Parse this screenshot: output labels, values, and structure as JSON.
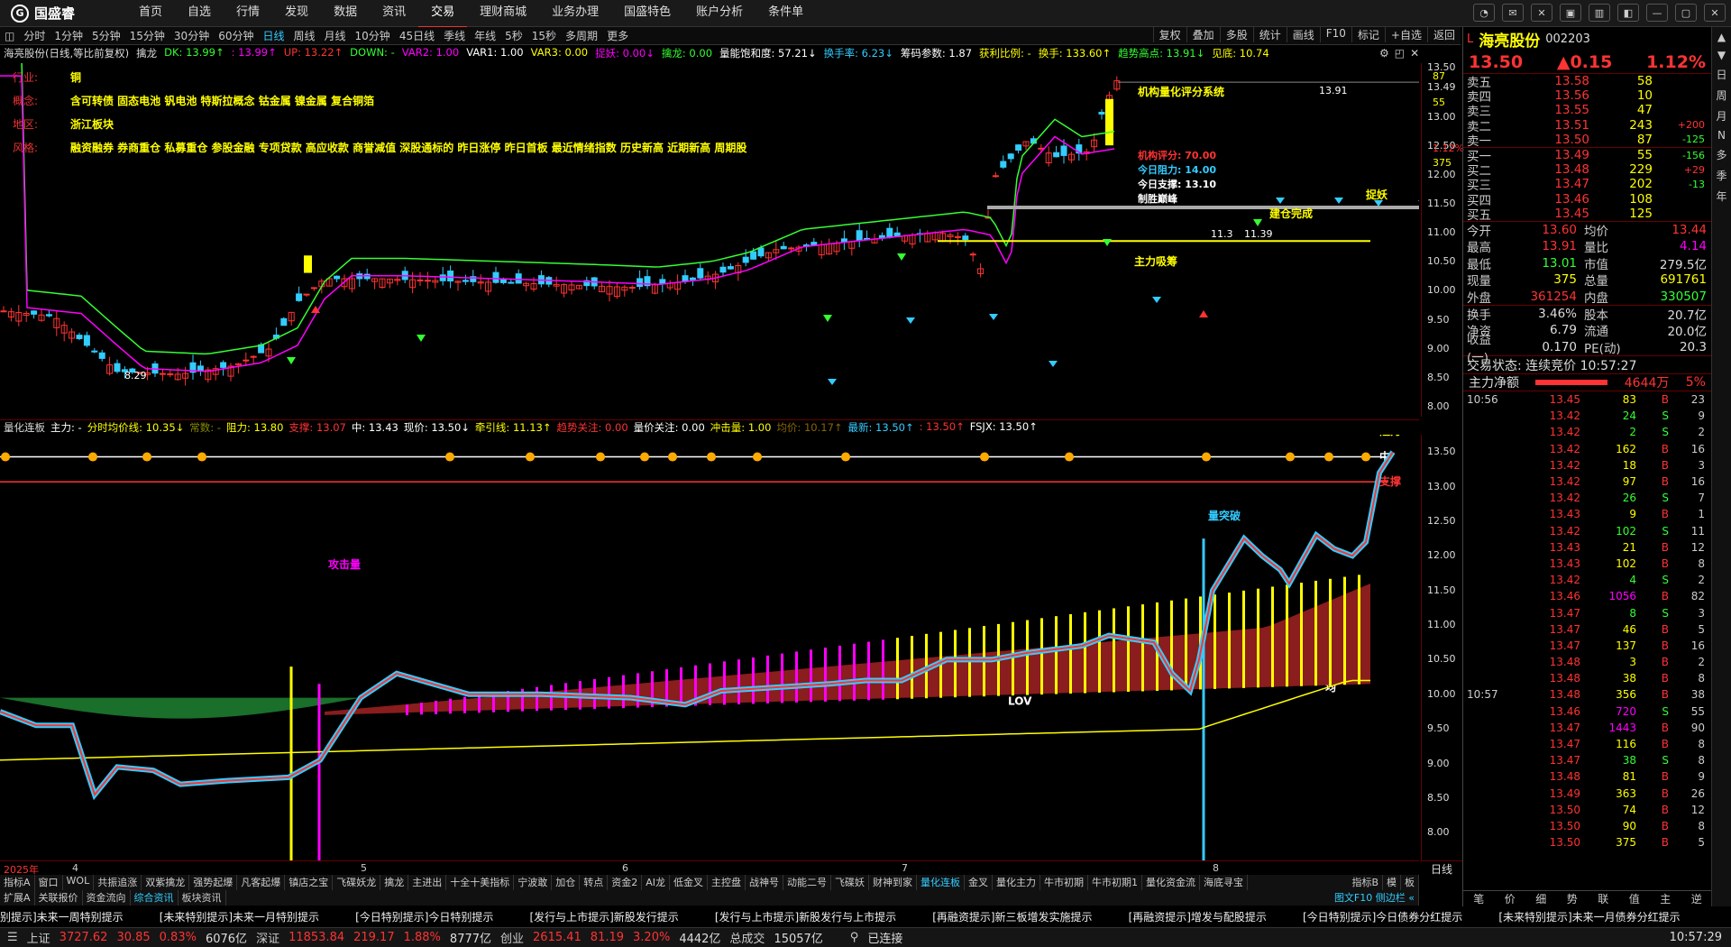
{
  "nav": {
    "brand": "国盛睿",
    "items": [
      "首页",
      "自选",
      "行情",
      "发现",
      "数据",
      "资讯",
      "交易",
      "理财商城",
      "业务办理",
      "国盛特色",
      "账户分析",
      "条件单"
    ],
    "active": "交易"
  },
  "periods": {
    "items": [
      "分时",
      "1分钟",
      "5分钟",
      "15分钟",
      "30分钟",
      "60分钟",
      "日线",
      "周线",
      "月线",
      "10分钟",
      "45日线",
      "季线",
      "年线",
      "5秒",
      "15秒",
      "多周期",
      "更多"
    ],
    "active": "日线",
    "right_tools": [
      "复权",
      "叠加",
      "多股",
      "统计",
      "画线",
      "F10",
      "标记",
      "+自选",
      "返回"
    ]
  },
  "infobar": [
    {
      "t": "海亮股份(日线,等比前复权)",
      "c": "#ddd"
    },
    {
      "t": "擒龙",
      "c": "#ddd"
    },
    {
      "t": "DK: 13.99↑",
      "c": "#3f3"
    },
    {
      "t": ": 13.99↑",
      "c": "#f0f"
    },
    {
      "t": "UP: 13.22↑",
      "c": "#f33"
    },
    {
      "t": "DOWN: -",
      "c": "#3f3"
    },
    {
      "t": "VAR2: 1.00",
      "c": "#f0f"
    },
    {
      "t": "VAR1: 1.00",
      "c": "#fff"
    },
    {
      "t": "VAR3: 0.00",
      "c": "#ff0"
    },
    {
      "t": "捉妖: 0.00↓",
      "c": "#f0f"
    },
    {
      "t": "擒龙: 0.00",
      "c": "#3f3"
    },
    {
      "t": "量能饱和度: 57.21↓",
      "c": "#fff"
    },
    {
      "t": "换手率: 6.23↓",
      "c": "#3cf"
    },
    {
      "t": "筹码参数: 1.87",
      "c": "#fff"
    },
    {
      "t": "获利比例: -",
      "c": "#ff0"
    },
    {
      "t": "换手: 133.60↑",
      "c": "#ff0"
    },
    {
      "t": "趋势高点: 13.91↓",
      "c": "#3f3"
    },
    {
      "t": "见底: 10.74",
      "c": "#ff0"
    }
  ],
  "attrs": [
    {
      "k": "行业:",
      "v": "铜"
    },
    {
      "k": "概念:",
      "v": "含可转债 固态电池 钒电池 特斯拉概念 钴金属 镍金属 复合铜箔"
    },
    {
      "k": "地区:",
      "v": "浙江板块"
    },
    {
      "k": "风格:",
      "v": "融资融券 券商重仓 私募重仓 参股金融 专项贷款 高应收款 商誉减值 深股通标的 昨日涨停 昨日首板 最近情绪指数 历史新高 近期新高 周期股"
    }
  ],
  "annot": {
    "box_title": "机构量化评分系统",
    "score": "机构评分: 70.00",
    "resist": "今日阻力: 14.00",
    "support": "今日支撑: 13.10",
    "win": "制胜巅峰",
    "build": "建仓完成",
    "zhuo": "捉妖",
    "mainbuy": "主力吸筹",
    "hi": "13.91",
    "lo": "8.29",
    "mid": "11.39",
    "mid2": "11.3"
  },
  "axis1": [
    "13.50",
    "13.49",
    "13.00",
    "12.50",
    "12.00",
    "11.50",
    "11.00",
    "10.50",
    "10.00",
    "9.50",
    "9.00",
    "8.50",
    "8.00"
  ],
  "axis1_extra": {
    "p87": "87",
    "p55": "55",
    "pct": "1.12%",
    "p375": "375"
  },
  "panel2": {
    "items": [
      {
        "t": "量化连板",
        "c": "#ddd"
      },
      {
        "t": "主力: -",
        "c": "#fff"
      },
      {
        "t": "分时均价线: 10.35↓",
        "c": "#ff0"
      },
      {
        "t": "常数: -",
        "c": "#880"
      },
      {
        "t": "阻力: 13.80",
        "c": "#ff0"
      },
      {
        "t": "支撑: 13.07",
        "c": "#f33"
      },
      {
        "t": "中: 13.43",
        "c": "#fff"
      },
      {
        "t": "现价: 13.50↓",
        "c": "#fff"
      },
      {
        "t": "牵引线: 11.13↑",
        "c": "#ff0"
      },
      {
        "t": "趋势关注: 0.00",
        "c": "#f33"
      },
      {
        "t": "量价关注: 0.00",
        "c": "#fff"
      },
      {
        "t": "冲击量: 1.00",
        "c": "#ff0"
      },
      {
        "t": "均价: 10.17↑",
        "c": "#860"
      },
      {
        "t": "最新: 13.50↑",
        "c": "#3cf"
      },
      {
        "t": ": 13.50↑",
        "c": "#f33"
      },
      {
        "t": "FSJX: 13.50↑",
        "c": "#fff"
      }
    ],
    "labels": {
      "resist": "阻力",
      "mid": "中",
      "support": "支撑",
      "attack": "攻击量",
      "break": "量突破",
      "lov": "LOV",
      "avg": "均"
    }
  },
  "axis2": [
    "13.50",
    "13.00",
    "12.50",
    "12.00",
    "11.50",
    "11.00",
    "10.50",
    "10.00",
    "9.50",
    "9.00",
    "8.50",
    "8.00"
  ],
  "dates": [
    "2025年",
    "4",
    "5",
    "6",
    "7",
    "8"
  ],
  "dates_right": "日线",
  "ind_tabs": {
    "items": [
      "指标A",
      "窗口",
      "WOL",
      "共振追涨",
      "双紫擒龙",
      "强势起爆",
      "凡客起爆",
      "镇店之宝",
      "飞碟妖龙",
      "擒龙",
      "主进出",
      "十全十美指标",
      "宁波敢",
      "加仓",
      "转点",
      "资金2",
      "AI龙",
      "低金叉",
      "主控盘",
      "战神号",
      "动能二号",
      "飞碟妖",
      "财神到家",
      "量化连板",
      "金叉",
      "量化主力",
      "牛市初期",
      "牛市初期1",
      "量化资金流",
      "海底寻宝"
    ],
    "active": "量化连板",
    "right": [
      "指标B",
      "模",
      "板"
    ]
  },
  "sub_tabs": {
    "items": [
      "扩展A",
      "关联报价",
      "资金流向",
      "综合资讯",
      "板块资讯"
    ],
    "active": "综合资讯",
    "right": "图文F10 侧边栏 «"
  },
  "ticker": [
    "别提示]未来一周特别提示",
    "[未来特别提示]未来一月特别提示",
    "[今日特别提示]今日特别提示",
    "[发行与上市提示]新股发行提示",
    "[发行与上市提示]新股发行与上市提示",
    "[再融资提示]新三板增发实施提示",
    "[再融资提示]增发与配股提示",
    "[今日特别提示]今日债券分红提示",
    "[未来特别提示]未来一月债券分红提示"
  ],
  "status": {
    "sh_name": "上证",
    "sh": "3727.62",
    "sh_chg": "30.85",
    "sh_pct": "0.83%",
    "sh_amt": "6076亿",
    "sz_name": "深证",
    "sz": "11853.84",
    "sz_chg": "219.17",
    "sz_pct": "1.88%",
    "sz_amt": "8777亿",
    "cy_name": "创业",
    "cy": "2615.41",
    "cy_chg": "81.19",
    "cy_pct": "3.20%",
    "cy_amt": "4442亿",
    "total_name": "总成交",
    "total": "15057亿",
    "conn": "已连接",
    "time": "10:57:29"
  },
  "stock": {
    "name": "海亮股份",
    "code": "002203",
    "price": "13.50",
    "chg": "▲0.15",
    "pct": "1.12%"
  },
  "orderbook": [
    {
      "l": "卖五",
      "p": "13.58",
      "v": "58",
      "d": ""
    },
    {
      "l": "卖四",
      "p": "13.56",
      "v": "10",
      "d": ""
    },
    {
      "l": "卖三",
      "p": "13.55",
      "v": "47",
      "d": ""
    },
    {
      "l": "卖二",
      "p": "13.51",
      "v": "243",
      "d": "+200"
    },
    {
      "l": "卖一",
      "p": "13.50",
      "v": "87",
      "d": "-125"
    },
    {
      "l": "买一",
      "p": "13.49",
      "v": "55",
      "d": "-156"
    },
    {
      "l": "买二",
      "p": "13.48",
      "v": "229",
      "d": "+29"
    },
    {
      "l": "买三",
      "p": "13.47",
      "v": "202",
      "d": "-13"
    },
    {
      "l": "买四",
      "p": "13.46",
      "v": "108",
      "d": ""
    },
    {
      "l": "买五",
      "p": "13.45",
      "v": "125",
      "d": ""
    }
  ],
  "stats": [
    {
      "k": "今开",
      "v": "13.60",
      "vc": "#f33",
      "k2": "均价",
      "v2": "13.44",
      "v2c": "#f33"
    },
    {
      "k": "最高",
      "v": "13.91",
      "vc": "#f33",
      "k2": "量比",
      "v2": "4.14",
      "v2c": "#f0f"
    },
    {
      "k": "最低",
      "v": "13.01",
      "vc": "#3f3",
      "k2": "市值",
      "v2": "279.5亿",
      "v2c": "#ddd"
    },
    {
      "k": "现量",
      "v": "375",
      "vc": "#ff0",
      "k2": "总量",
      "v2": "691761",
      "v2c": "#ff0"
    },
    {
      "k": "外盘",
      "v": "361254",
      "vc": "#f33",
      "k2": "内盘",
      "v2": "330507",
      "v2c": "#3f3"
    },
    {
      "k": "换手",
      "v": "3.46%",
      "vc": "#ddd",
      "k2": "股本",
      "v2": "20.7亿",
      "v2c": "#ddd"
    },
    {
      "k": "净资",
      "v": "6.79",
      "vc": "#ddd",
      "k2": "流通",
      "v2": "20.0亿",
      "v2c": "#ddd"
    },
    {
      "k": "收益(一)",
      "v": "0.170",
      "vc": "#ddd",
      "k2": "PE(动)",
      "v2": "20.3",
      "v2c": "#ddd"
    }
  ],
  "trade_state": "交易状态: 连续竞价 10:57:27",
  "zljh": {
    "label": "主力净额",
    "value": "4644万",
    "pct": "5%"
  },
  "ticks": [
    {
      "t": "10:56",
      "p": "13.45",
      "v": "83",
      "s": "B",
      "n": "23"
    },
    {
      "t": "",
      "p": "13.42",
      "v": "24",
      "s": "S",
      "n": "9"
    },
    {
      "t": "",
      "p": "13.42",
      "v": "2",
      "s": "S",
      "n": "2"
    },
    {
      "t": "",
      "p": "13.42",
      "v": "162",
      "s": "B",
      "n": "16"
    },
    {
      "t": "",
      "p": "13.42",
      "v": "18",
      "s": "B",
      "n": "3"
    },
    {
      "t": "",
      "p": "13.42",
      "v": "97",
      "s": "B",
      "n": "16"
    },
    {
      "t": "",
      "p": "13.42",
      "v": "26",
      "s": "S",
      "n": "7"
    },
    {
      "t": "",
      "p": "13.43",
      "v": "9",
      "s": "B",
      "n": "1"
    },
    {
      "t": "",
      "p": "13.42",
      "v": "102",
      "s": "S",
      "n": "11"
    },
    {
      "t": "",
      "p": "13.43",
      "v": "21",
      "s": "B",
      "n": "12"
    },
    {
      "t": "",
      "p": "13.43",
      "v": "102",
      "s": "B",
      "n": "8"
    },
    {
      "t": "",
      "p": "13.42",
      "v": "4",
      "s": "S",
      "n": "2"
    },
    {
      "t": "",
      "p": "13.46",
      "v": "1056",
      "s": "B",
      "n": "82"
    },
    {
      "t": "",
      "p": "13.47",
      "v": "8",
      "s": "S",
      "n": "3"
    },
    {
      "t": "",
      "p": "13.47",
      "v": "46",
      "s": "B",
      "n": "5"
    },
    {
      "t": "",
      "p": "13.47",
      "v": "137",
      "s": "B",
      "n": "16"
    },
    {
      "t": "",
      "p": "13.48",
      "v": "3",
      "s": "B",
      "n": "2"
    },
    {
      "t": "",
      "p": "13.48",
      "v": "38",
      "s": "B",
      "n": "8"
    },
    {
      "t": "10:57",
      "p": "13.48",
      "v": "356",
      "s": "B",
      "n": "38"
    },
    {
      "t": "",
      "p": "13.46",
      "v": "720",
      "s": "S",
      "n": "55"
    },
    {
      "t": "",
      "p": "13.47",
      "v": "1443",
      "s": "B",
      "n": "90"
    },
    {
      "t": "",
      "p": "13.47",
      "v": "116",
      "s": "B",
      "n": "8"
    },
    {
      "t": "",
      "p": "13.47",
      "v": "38",
      "s": "S",
      "n": "8"
    },
    {
      "t": "",
      "p": "13.48",
      "v": "81",
      "s": "B",
      "n": "9"
    },
    {
      "t": "",
      "p": "13.49",
      "v": "363",
      "s": "B",
      "n": "26"
    },
    {
      "t": "",
      "p": "13.50",
      "v": "74",
      "s": "B",
      "n": "12"
    },
    {
      "t": "",
      "p": "13.50",
      "v": "90",
      "s": "B",
      "n": "8"
    },
    {
      "t": "",
      "p": "13.50",
      "v": "375",
      "s": "B",
      "n": "5"
    }
  ],
  "rtabs": [
    "笔",
    "价",
    "细",
    "势",
    "联",
    "值",
    "主",
    "逆"
  ],
  "farright": [
    "▲",
    "▼",
    "日",
    "周",
    "月",
    "N",
    "多",
    "季",
    "年"
  ]
}
